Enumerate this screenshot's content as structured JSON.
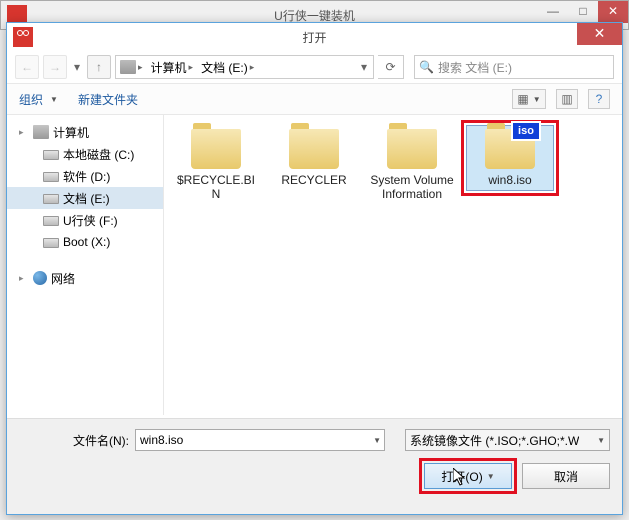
{
  "bg_window": {
    "title": "U行侠一键装机"
  },
  "dialog": {
    "title": "打开"
  },
  "breadcrumb": {
    "seg1": "计算机",
    "seg2": "文档 (E:)"
  },
  "search": {
    "placeholder": "搜索 文档 (E:)"
  },
  "toolbar": {
    "organize": "组织",
    "new_folder": "新建文件夹"
  },
  "sidebar": {
    "computer": "计算机",
    "drives": [
      {
        "label": "本地磁盘 (C:)"
      },
      {
        "label": "软件 (D:)"
      },
      {
        "label": "文档 (E:)"
      },
      {
        "label": "U行侠 (F:)"
      },
      {
        "label": "Boot (X:)"
      }
    ],
    "network": "网络"
  },
  "files": [
    {
      "name": "$RECYCLE.BIN",
      "type": "folder"
    },
    {
      "name": "RECYCLER",
      "type": "folder"
    },
    {
      "name": "System Volume Information",
      "type": "folder"
    },
    {
      "name": "win8.iso",
      "type": "iso",
      "selected": true,
      "highlighted": true
    }
  ],
  "footer": {
    "filename_label": "文件名(N):",
    "filename_value": "win8.iso",
    "filter": "系统镜像文件 (*.ISO;*.GHO;*.W",
    "open": "打开(O)",
    "cancel": "取消"
  },
  "iso_badge": "iso"
}
